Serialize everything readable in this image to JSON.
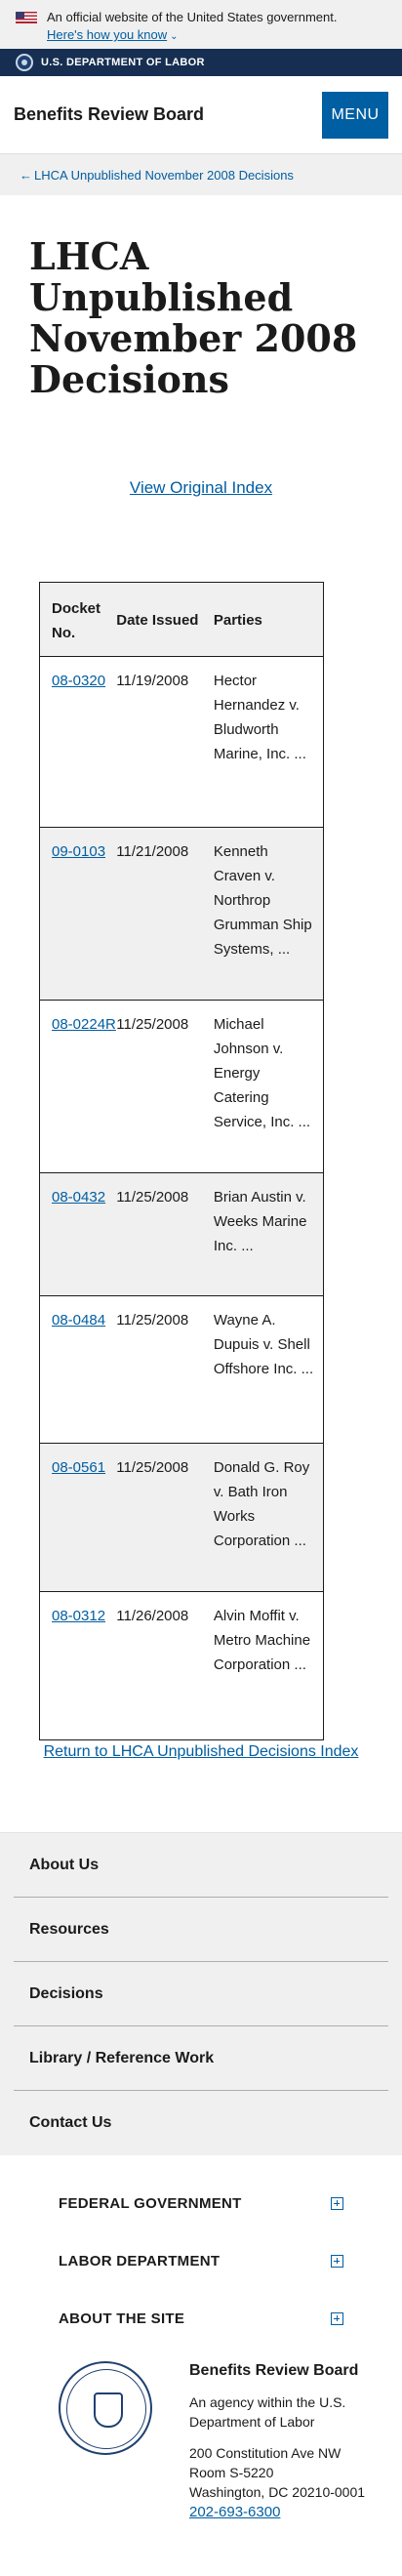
{
  "gov_banner": {
    "text": "An official website of the United States government.",
    "how_link": "Here's how you know"
  },
  "dol_bar": {
    "label": "U.S. DEPARTMENT OF LABOR"
  },
  "header": {
    "site_title": "Benefits Review Board",
    "menu_label": "MENU"
  },
  "breadcrumb": {
    "label": "LHCA Unpublished November 2008 Decisions"
  },
  "page_title": "LHCA Unpublished November 2008 Decisions",
  "view_original": "View Original Index",
  "table": {
    "headers": [
      "Docket No.",
      "Date Issued",
      "Parties"
    ],
    "rows": [
      {
        "docket": "08-0320",
        "date": "11/19/2008",
        "parties": "Hector Hernandez v. Bludworth Marine, Inc. ..."
      },
      {
        "docket": "09-0103",
        "date": "11/21/2008",
        "parties": "Kenneth Craven v. Northrop Grumman Ship Systems, ..."
      },
      {
        "docket": "08-0224R",
        "date": "11/25/2008",
        "parties": "Michael Johnson v. Energy Catering Service, Inc. ..."
      },
      {
        "docket": "08-0432",
        "date": "11/25/2008",
        "parties": "Brian Austin v. Weeks Marine Inc. ..."
      },
      {
        "docket": "08-0484",
        "date": "11/25/2008",
        "parties": "Wayne A. Dupuis v. Shell Offshore Inc. ..."
      },
      {
        "docket": "08-0561",
        "date": "11/25/2008",
        "parties": "Donald G. Roy v. Bath Iron Works Corporation ..."
      },
      {
        "docket": "08-0312",
        "date": "11/26/2008",
        "parties": "Alvin Moffit v. Metro Machine Corporation ..."
      }
    ]
  },
  "return_link": "Return to LHCA Unpublished Decisions Index",
  "footer_nav": [
    "About Us",
    "Resources",
    "Decisions",
    "Library / Reference Work",
    "Contact Us"
  ],
  "footer_accordion": [
    "FEDERAL GOVERNMENT",
    "LABOR DEPARTMENT",
    "ABOUT THE SITE"
  ],
  "footer_agency": {
    "name": "Benefits Review Board",
    "description": "An agency within the U.S. Department of Labor",
    "address_line1": "200 Constitution Ave NW",
    "address_line2": "Room S-5220",
    "address_line3": "Washington, DC 20210-0001",
    "phone": "202-693-6300"
  },
  "icons": {
    "flag": "us-flag-icon",
    "dol_seal": "dol-seal-icon",
    "plus": "plus-icon",
    "chevron": "chevron-down-icon",
    "back_arrow": "arrow-left-icon"
  },
  "colors": {
    "link": "#005ea2",
    "dol_bar": "#162e51",
    "menu_button": "#005ea2",
    "banner_bg": "#f0f0f0"
  }
}
